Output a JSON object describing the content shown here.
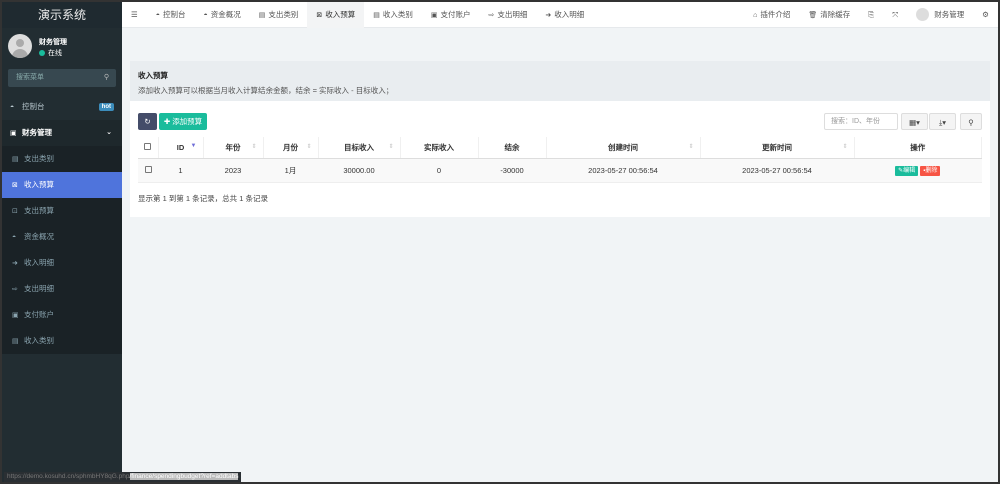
{
  "app": {
    "title": "演示系统"
  },
  "user": {
    "name": "财务管理",
    "status": "在线"
  },
  "sidebar": {
    "search_placeholder": "搜索菜单",
    "items": [
      {
        "label": "控制台",
        "icon": "dashboard-icon",
        "badge": "hot"
      },
      {
        "label": "财务管理",
        "icon": "money-icon"
      }
    ],
    "sub": [
      {
        "label": "支出类别",
        "icon": "list-icon"
      },
      {
        "label": "收入预算",
        "icon": "budget-icon",
        "active": true
      },
      {
        "label": "支出预算",
        "icon": "budget-out-icon"
      },
      {
        "label": "资金概况",
        "icon": "dashboard-icon"
      },
      {
        "label": "收入明细",
        "icon": "sign-in-icon"
      },
      {
        "label": "支出明细",
        "icon": "sign-out-icon"
      },
      {
        "label": "支付账户",
        "icon": "account-icon"
      },
      {
        "label": "收入类别",
        "icon": "list-icon"
      }
    ]
  },
  "topbar": {
    "tabs": [
      "控制台",
      "资金概况",
      "支出类别",
      "收入预算",
      "收入类别",
      "支付账户",
      "支出明细",
      "收入明细"
    ],
    "plugin": "插件介绍",
    "clear_cache": "清除缓存",
    "user": "财务管理"
  },
  "panel": {
    "title": "收入预算",
    "desc": "添加收入预算可以根据当月收入计算结余金额，结余 = 实际收入 - 目标收入；",
    "add_label": "添加预算",
    "search_placeholder": "搜索：ID、年份"
  },
  "table": {
    "headers": [
      "ID",
      "年份",
      "月份",
      "目标收入",
      "实际收入",
      "结余",
      "创建时间",
      "更新时间",
      "操作"
    ],
    "rows": [
      [
        "1",
        "2023",
        "1月",
        "30000.00",
        "0",
        "-30000",
        "2023-05-27 00:56:54",
        "2023-05-27 00:56:54"
      ]
    ],
    "edit_label": "编辑",
    "delete_label": "删除",
    "pagination_info": "显示第 1 到第 1 条记录，总共 1 条记录"
  },
  "status_url": {
    "prefix": "https://demo.kosuhd.cn/sphmbHY8qG.php",
    "suffix": "/finance/spendingbudget?ref=addtabs"
  },
  "colors": {
    "active": "#4f74dc",
    "success": "#1abc9c",
    "danger": "#f75444"
  }
}
